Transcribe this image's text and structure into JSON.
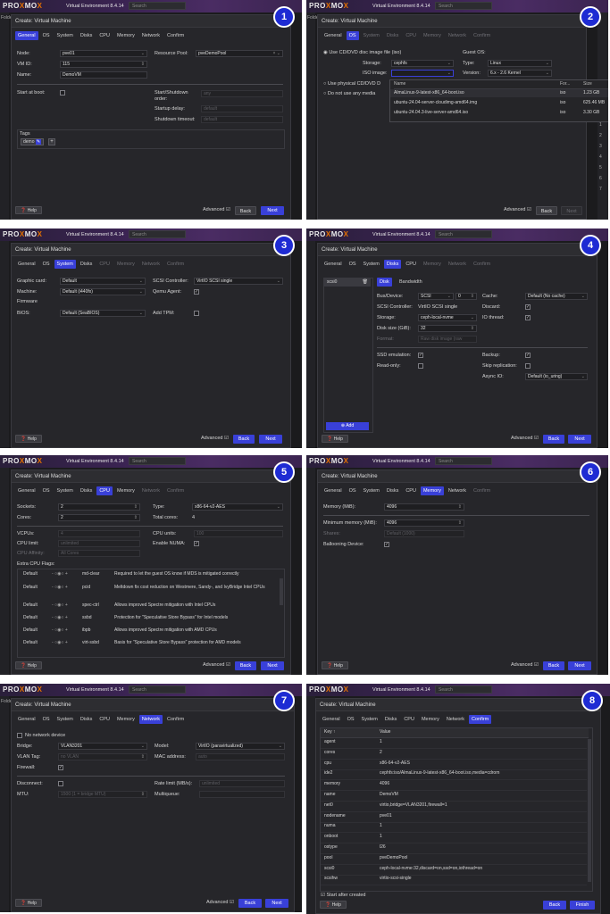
{
  "app": {
    "logo_left": "PRO",
    "logo_x": "X",
    "logo_mid": "MO",
    "logo_end": "X",
    "version": "Virtual Environment 8.4.14",
    "search_placeholder": "Search",
    "dialog_title": "Create: Virtual Machine",
    "bg_tree_label": "Folde"
  },
  "tabs": [
    "General",
    "OS",
    "System",
    "Disks",
    "CPU",
    "Memory",
    "Network",
    "Confirm"
  ],
  "common": {
    "help": "Help",
    "advanced": "Advanced",
    "back": "Back",
    "next": "Next",
    "finish": "Finish"
  },
  "p1": {
    "badge": "1",
    "node_label": "Node:",
    "node_value": "pve01",
    "vmid_label": "VM ID:",
    "vmid_value": "115",
    "name_label": "Name:",
    "name_value": "DemoVM",
    "pool_label": "Resource Pool:",
    "pool_value": "pveDemoPool",
    "start_boot_label": "Start at boot:",
    "order_label": "Start/Shutdown order:",
    "order_value": "any",
    "delay_label": "Startup delay:",
    "delay_value": "default",
    "timeout_label": "Shutdown timeout:",
    "timeout_value": "default",
    "tags_label": "Tags",
    "tag_value": "demo"
  },
  "p2": {
    "badge": "2",
    "use_iso": "Use CD/DVD disc image file (iso)",
    "storage_label": "Storage:",
    "storage_value": "cephfs",
    "iso_label": "ISO image:",
    "physical": "Use physical CD/DVD D",
    "no_media": "Do not use any media",
    "guest_os": "Guest OS:",
    "type_label": "Type:",
    "type_value": "Linux",
    "version_label": "Version:",
    "version_value": "6.x - 2.6 Kernel",
    "col_name": "Name",
    "col_format": "For...",
    "col_size": "Size",
    "isos": [
      {
        "name": "AlmaLinux-9-latest-x86_64-boot.iso",
        "format": "iso",
        "size": "1.23 GB"
      },
      {
        "name": "ubuntu-24.04-server-cloudimg-amd64.img",
        "format": "iso",
        "size": "625.46 MB"
      },
      {
        "name": "ubuntu-24.04.3-live-server-amd64.iso",
        "format": "iso",
        "size": "3.30 GB"
      }
    ],
    "side_numbers": [
      "1",
      "2",
      "3",
      "4",
      "5",
      "6",
      "7"
    ]
  },
  "p3": {
    "badge": "3",
    "graphic_label": "Graphic card:",
    "graphic_value": "Default",
    "machine_label": "Machine:",
    "machine_value": "Default (i440fx)",
    "firmware_label": "Firmware",
    "bios_label": "BIOS:",
    "bios_value": "Default (SeaBIOS)",
    "scsi_label": "SCSI Controller:",
    "scsi_value": "VirtIO SCSI single",
    "qemu_label": "Qemu Agent:",
    "tpm_label": "Add TPM:"
  },
  "p4": {
    "badge": "4",
    "disk_item": "scsi0",
    "add": "Add",
    "subtab_disk": "Disk",
    "subtab_bw": "Bandwidth",
    "bus_label": "Bus/Device:",
    "bus_value": "SCSI",
    "bus_num": "0",
    "scsi_label": "SCSI Controller:",
    "scsi_value": "VirtIO SCSI single",
    "storage_label": "Storage:",
    "storage_value": "ceph-local-nvme",
    "size_label": "Disk size (GiB):",
    "size_value": "32",
    "format_label": "Format:",
    "format_value": "Raw disk image (raw",
    "cache_label": "Cache:",
    "cache_value": "Default (No cache)",
    "discard_label": "Discard:",
    "io_label": "IO thread:",
    "ssd_label": "SSD emulation:",
    "ro_label": "Read-only:",
    "backup_label": "Backup:",
    "skip_label": "Skip replication:",
    "async_label": "Async IO:",
    "async_value": "Default (io_uring)"
  },
  "p5": {
    "badge": "5",
    "sockets_label": "Sockets:",
    "sockets_value": "2",
    "cores_label": "Cores:",
    "cores_value": "2",
    "type_label": "Type:",
    "type_value": "x86-64-v2-AES",
    "total_label": "Total cores:",
    "total_value": "4",
    "vcpu_label": "VCPUs:",
    "vcpu_value": "4",
    "limit_label": "CPU limit:",
    "limit_value": "unlimited",
    "affinity_label": "CPU Affinity:",
    "affinity_value": "All Cores",
    "units_label": "CPU units:",
    "units_value": "100",
    "numa_label": "Enable NUMA:",
    "flags_label": "Extra CPU Flags:",
    "flags": [
      {
        "state": "Default",
        "name": "md-clear",
        "desc": "Required to let the guest OS know if MDS is mitigated correctly"
      },
      {
        "state": "Default",
        "name": "pcid",
        "desc": "Meltdown fix cost reduction on Westmere, Sandy-, and IvyBridge Intel CPUs"
      },
      {
        "state": "Default",
        "name": "spec-ctrl",
        "desc": "Allows improved Spectre mitigation with Intel CPUs"
      },
      {
        "state": "Default",
        "name": "ssbd",
        "desc": "Protection for \"Speculative Store Bypass\" for Intel models"
      },
      {
        "state": "Default",
        "name": "ibpb",
        "desc": "Allows improved Spectre mitigation with AMD CPUs"
      },
      {
        "state": "Default",
        "name": "virt-ssbd",
        "desc": "Basis for \"Speculative Store Bypass\" protection for AMD models"
      }
    ]
  },
  "p6": {
    "badge": "6",
    "mem_label": "Memory (MiB):",
    "mem_value": "4096",
    "min_label": "Minimum memory (MiB):",
    "min_value": "4096",
    "shares_label": "Shares:",
    "shares_value": "Default (1000)",
    "balloon_label": "Ballooning Device:"
  },
  "p7": {
    "badge": "7",
    "no_net": "No network device",
    "bridge_label": "Bridge:",
    "bridge_value": "VLAN3201",
    "vlan_label": "VLAN Tag:",
    "vlan_value": "no VLAN",
    "firewall_label": "Firewall:",
    "model_label": "Model:",
    "model_value": "VirtIO (paravirtualized)",
    "mac_label": "MAC address:",
    "mac_value": "auto",
    "disconnect_label": "Disconnect:",
    "mtu_label": "MTU:",
    "mtu_value": "1500 (1 = bridge MTU)",
    "rate_label": "Rate limit (MB/s):",
    "rate_value": "unlimited",
    "multi_label": "Multiqueue:"
  },
  "p8": {
    "badge": "8",
    "col_key": "Key ↑",
    "col_value": "Value",
    "rows": [
      {
        "k": "agent",
        "v": "1"
      },
      {
        "k": "cores",
        "v": "2"
      },
      {
        "k": "cpu",
        "v": "x86-64-v2-AES"
      },
      {
        "k": "ide2",
        "v": "cephfs:iso/AlmaLinux-9-latest-x86_64-boot.iso,media=cdrom"
      },
      {
        "k": "memory",
        "v": "4096"
      },
      {
        "k": "name",
        "v": "DemoVM"
      },
      {
        "k": "net0",
        "v": "virtio,bridge=VLAN3201,firewall=1"
      },
      {
        "k": "nodename",
        "v": "pve01"
      },
      {
        "k": "numa",
        "v": "1"
      },
      {
        "k": "onboot",
        "v": "1"
      },
      {
        "k": "ostype",
        "v": "l26"
      },
      {
        "k": "pool",
        "v": "pveDemoPool"
      },
      {
        "k": "scsi0",
        "v": "ceph-local-nvme:32,discard=on,ssd=on,iothread=on"
      },
      {
        "k": "scsihw",
        "v": "virtio-scsi-single"
      }
    ],
    "start_after": "Start after created"
  },
  "colors": {
    "accent": "#3940d8",
    "badge": "#1e2bd3",
    "panel_bg": "#1b1b1d",
    "dialog_bg": "#26262a"
  }
}
